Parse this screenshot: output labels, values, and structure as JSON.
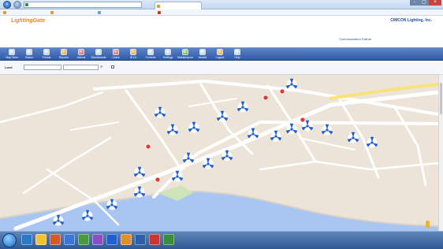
{
  "browser": {
    "url": "",
    "address_buttons": "",
    "tab_title": "",
    "window_controls": [
      "-",
      "▢",
      "×"
    ]
  },
  "favorites": [
    "",
    "",
    "",
    ""
  ],
  "app": {
    "logo_main": "LightingGate",
    "logo_tagline": "",
    "company": "CIMCON Lighting, Inc.",
    "user_line": "",
    "breadcrumb": "",
    "alert_links": {
      "first": "",
      "second": "Communication Failure"
    }
  },
  "toolbar": [
    "Map View",
    "Status",
    "Trends",
    "Reports",
    "Alarms",
    "Dashboards",
    "Users",
    "SLCs",
    "Controls",
    "Settings",
    "Maintenance",
    "Assets",
    "Logout",
    "Help"
  ],
  "filter": {
    "label": "Land",
    "select_value": "",
    "go_icon": "search-icon",
    "checkbox_label": ""
  },
  "map": {
    "street_labels": []
  },
  "taskbar": {
    "time": "",
    "date": ""
  }
}
